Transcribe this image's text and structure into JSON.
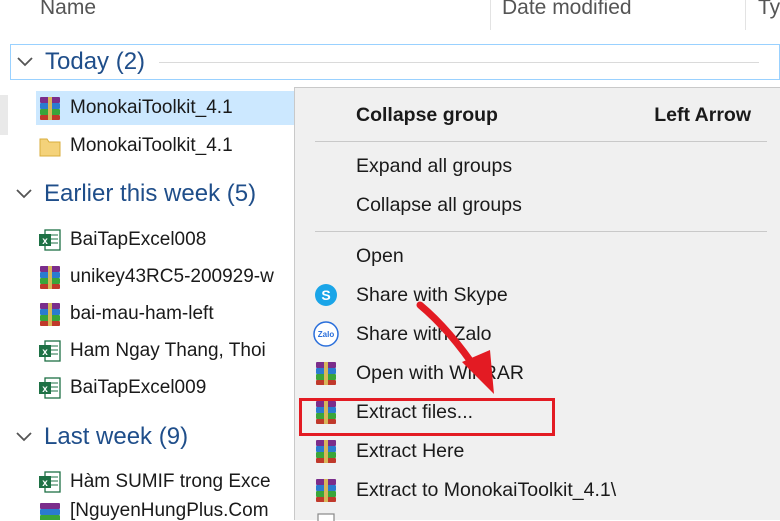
{
  "columns": {
    "name": "Name",
    "date_modified": "Date modified",
    "type": "Typ"
  },
  "groups": {
    "today": {
      "title": "Today (2)"
    },
    "earlier": {
      "title": "Earlier this week (5)"
    },
    "lastweek": {
      "title": "Last week (9)"
    }
  },
  "files": {
    "today": [
      {
        "name": "MonokaiToolkit_4.1",
        "icon": "winrar-archive-icon"
      },
      {
        "name": "MonokaiToolkit_4.1",
        "icon": "folder-icon"
      }
    ],
    "earlier": [
      {
        "name": "BaiTapExcel008",
        "icon": "excel-file-icon"
      },
      {
        "name": "unikey43RC5-200929-w",
        "icon": "winrar-archive-icon"
      },
      {
        "name": "bai-mau-ham-left",
        "icon": "winrar-archive-icon"
      },
      {
        "name": "Ham Ngay Thang, Thoi",
        "icon": "excel-file-icon"
      },
      {
        "name": "BaiTapExcel009",
        "icon": "excel-file-icon"
      }
    ],
    "lastweek": [
      {
        "name": "Hàm SUMIF trong Exce",
        "icon": "excel-file-icon"
      },
      {
        "name": "[NguyenHungPlus.Com",
        "icon": "winrar-archive-icon"
      }
    ]
  },
  "context_menu": {
    "collapse_group": "Collapse group",
    "collapse_group_key": "Left Arrow",
    "expand_all": "Expand all groups",
    "collapse_all": "Collapse all groups",
    "open": "Open",
    "share_skype": "Share with Skype",
    "share_zalo": "Share with Zalo",
    "zalo_icon_text": "Zalo",
    "open_winrar": "Open with WinRAR",
    "extract_files": "Extract files...",
    "extract_here": "Extract Here",
    "extract_to": "Extract to MonokaiToolkit_4.1\\"
  },
  "colors": {
    "selection": "#cce8ff",
    "menu_bg": "#f0f0f0",
    "highlight_box": "#e31b23",
    "group_title": "#1f4e8a"
  }
}
